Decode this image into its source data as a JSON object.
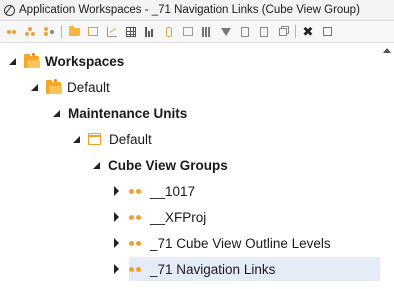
{
  "window": {
    "title": "Application Workspaces - _71 Navigation Links (Cube View Group)"
  },
  "toolbar": {
    "buttons": [
      "dots-icon",
      "hierarchy-icon",
      "add-member-icon",
      "folder-icon",
      "box-icon",
      "chart-icon",
      "grid-icon",
      "bars-icon",
      "cylinder-icon",
      "panel-icon",
      "columns-icon",
      "filter-icon",
      "document-icon",
      "document-list-icon",
      "copy-icon",
      "delete-icon",
      "edit-icon"
    ]
  },
  "tree": {
    "workspaces": "Workspaces",
    "default_workspace": "Default",
    "maintenance_units": "Maintenance Units",
    "default_unit": "Default",
    "cube_view_groups": "Cube View Groups",
    "groups": [
      {
        "label": "__1017"
      },
      {
        "label": "__XFProj"
      },
      {
        "label": "_71 Cube View Outline Levels"
      },
      {
        "label": "_71 Navigation Links",
        "selected": true
      }
    ]
  },
  "colors": {
    "accent_orange": "#f0a030",
    "selection": "#e5ebf7"
  }
}
